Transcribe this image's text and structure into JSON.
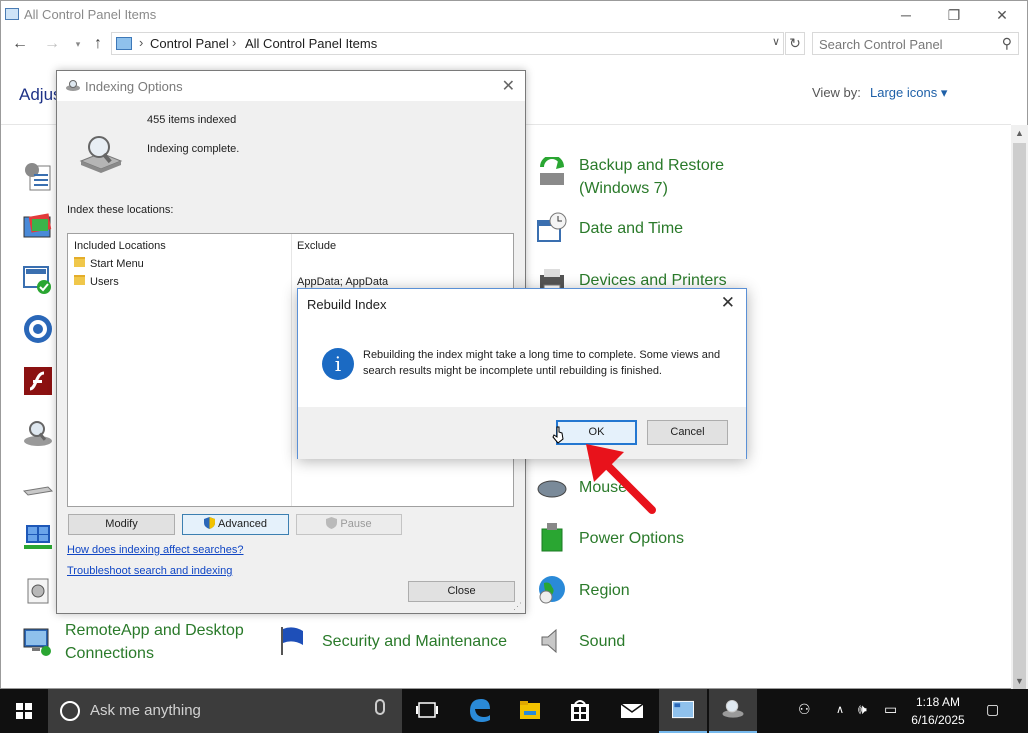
{
  "control_panel": {
    "window_title": "All Control Panel Items",
    "breadcrumbs": [
      "Control Panel",
      "All Control Panel Items"
    ],
    "search_placeholder": "Search Control Panel",
    "heading": "Adjus",
    "view_by_label": "View by:",
    "view_by_value": "Large icons ▾",
    "items": {
      "backup": "Backup and Restore",
      "backup2": "(Windows 7)",
      "datetime": "Date and Time",
      "devices": "Devices and Printers",
      "mouse": "Mouse",
      "power": "Power Options",
      "region": "Region",
      "remoteapp": "RemoteApp and Desktop",
      "remoteapp2": "Connections",
      "security": "Security and Maintenance",
      "sound": "Sound"
    }
  },
  "indexing": {
    "title": "Indexing Options",
    "items_indexed": "455 items indexed",
    "status": "Indexing complete.",
    "locations_label": "Index these locations:",
    "table": {
      "col_included": "Included Locations",
      "col_exclude": "Exclude",
      "rows": [
        {
          "location": "Start Menu",
          "exclude": ""
        },
        {
          "location": "Users",
          "exclude": "AppData; AppData"
        }
      ]
    },
    "buttons": {
      "modify": "Modify",
      "advanced": "Advanced",
      "pause": "Pause",
      "close": "Close"
    },
    "links": {
      "how": "How does indexing affect searches?",
      "troubleshoot": "Troubleshoot search and indexing"
    }
  },
  "rebuild_dialog": {
    "title": "Rebuild Index",
    "message": "Rebuilding the index might take a long time to complete. Some views and search results might be incomplete until rebuilding is finished.",
    "ok": "OK",
    "cancel": "Cancel"
  },
  "taskbar": {
    "search_placeholder": "Ask me anything",
    "time": "1:18 AM",
    "date": "6/16/2025"
  },
  "colors": {
    "link_green": "#2a7a2a",
    "accent_blue": "#1b6ac3",
    "taskbar": "#101010",
    "annotation_red": "#e8121b"
  }
}
